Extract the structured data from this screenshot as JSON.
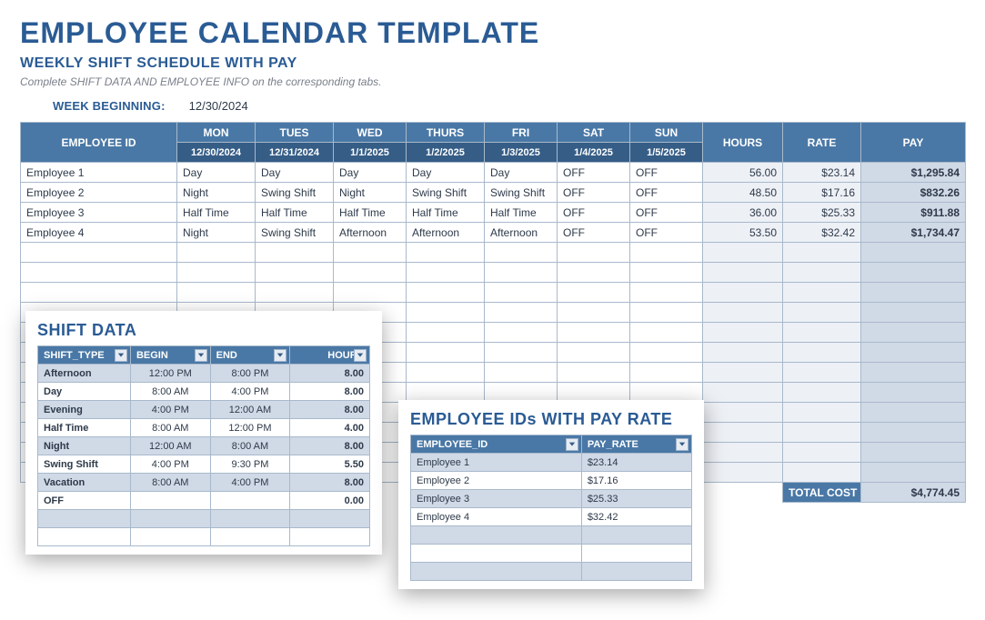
{
  "header": {
    "title": "EMPLOYEE CALENDAR TEMPLATE",
    "subtitle": "WEEKLY SHIFT SCHEDULE WITH PAY",
    "instruction": "Complete SHIFT DATA AND EMPLOYEE INFO on the corresponding tabs.",
    "week_label": "WEEK BEGINNING:",
    "week_value": "12/30/2024"
  },
  "main_table": {
    "col_employee": "EMPLOYEE ID",
    "days": [
      "MON",
      "TUES",
      "WED",
      "THURS",
      "FRI",
      "SAT",
      "SUN"
    ],
    "dates": [
      "12/30/2024",
      "12/31/2024",
      "1/1/2025",
      "1/2/2025",
      "1/3/2025",
      "1/4/2025",
      "1/5/2025"
    ],
    "col_hours": "HOURS",
    "col_rate": "RATE",
    "col_pay": "PAY",
    "rows": [
      {
        "id": "Employee 1",
        "shifts": [
          "Day",
          "Day",
          "Day",
          "Day",
          "Day",
          "OFF",
          "OFF"
        ],
        "hours": "56.00",
        "rate": "$23.14",
        "pay": "$1,295.84"
      },
      {
        "id": "Employee 2",
        "shifts": [
          "Night",
          "Swing Shift",
          "Night",
          "Swing Shift",
          "Swing Shift",
          "OFF",
          "OFF"
        ],
        "hours": "48.50",
        "rate": "$17.16",
        "pay": "$832.26"
      },
      {
        "id": "Employee 3",
        "shifts": [
          "Half Time",
          "Half Time",
          "Half Time",
          "Half Time",
          "Half Time",
          "OFF",
          "OFF"
        ],
        "hours": "36.00",
        "rate": "$25.33",
        "pay": "$911.88"
      },
      {
        "id": "Employee 4",
        "shifts": [
          "Night",
          "Swing Shift",
          "Afternoon",
          "Afternoon",
          "Afternoon",
          "OFF",
          "OFF"
        ],
        "hours": "53.50",
        "rate": "$32.42",
        "pay": "$1,734.47"
      }
    ],
    "empty_rows": 12,
    "total_label": "TOTAL COST",
    "total_value": "$4,774.45"
  },
  "shift_panel": {
    "title": "SHIFT DATA",
    "cols": [
      "SHIFT_TYPE",
      "BEGIN",
      "END",
      "HOURS"
    ],
    "rows": [
      {
        "type": "Afternoon",
        "begin": "12:00 PM",
        "end": "8:00 PM",
        "hours": "8.00"
      },
      {
        "type": "Day",
        "begin": "8:00 AM",
        "end": "4:00 PM",
        "hours": "8.00"
      },
      {
        "type": "Evening",
        "begin": "4:00 PM",
        "end": "12:00 AM",
        "hours": "8.00"
      },
      {
        "type": "Half Time",
        "begin": "8:00 AM",
        "end": "12:00 PM",
        "hours": "4.00"
      },
      {
        "type": "Night",
        "begin": "12:00 AM",
        "end": "8:00 AM",
        "hours": "8.00"
      },
      {
        "type": "Swing Shift",
        "begin": "4:00 PM",
        "end": "9:30 PM",
        "hours": "5.50"
      },
      {
        "type": "Vacation",
        "begin": "8:00 AM",
        "end": "4:00 PM",
        "hours": "8.00"
      },
      {
        "type": "OFF",
        "begin": "",
        "end": "",
        "hours": "0.00"
      }
    ],
    "empty_rows": 2
  },
  "emp_panel": {
    "title": "EMPLOYEE IDs WITH PAY RATE",
    "cols": [
      "EMPLOYEE_ID",
      "PAY_RATE"
    ],
    "rows": [
      {
        "id": "Employee 1",
        "rate": "$23.14"
      },
      {
        "id": "Employee 2",
        "rate": "$17.16"
      },
      {
        "id": "Employee 3",
        "rate": "$25.33"
      },
      {
        "id": "Employee 4",
        "rate": "$32.42"
      }
    ],
    "empty_rows": 3
  }
}
